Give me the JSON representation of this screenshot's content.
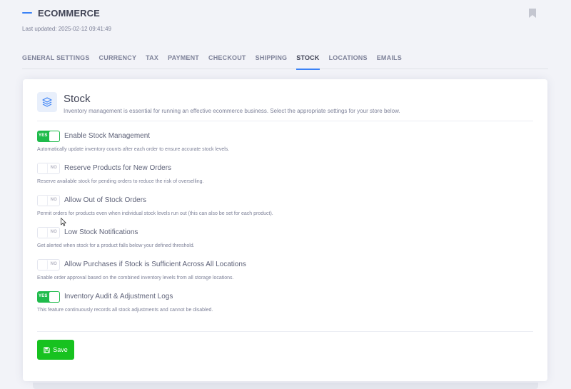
{
  "header": {
    "title": "ECOMMERCE",
    "last_updated": "Last updated: 2025-02-12 09:41:49"
  },
  "tabs": [
    {
      "label": "GENERAL SETTINGS",
      "active": false
    },
    {
      "label": "CURRENCY",
      "active": false
    },
    {
      "label": "TAX",
      "active": false
    },
    {
      "label": "PAYMENT",
      "active": false
    },
    {
      "label": "CHECKOUT",
      "active": false
    },
    {
      "label": "SHIPPING",
      "active": false
    },
    {
      "label": "STOCK",
      "active": true
    },
    {
      "label": "LOCATIONS",
      "active": false
    },
    {
      "label": "EMAILS",
      "active": false
    }
  ],
  "section": {
    "title": "Stock",
    "description": "Inventory management is essential for running an effective ecommerce business. Select the appropriate settings for your store below."
  },
  "options": [
    {
      "label": "Enable Stock Management",
      "state": "YES",
      "help": "Automatically update inventory counts after each order to ensure accurate stock levels."
    },
    {
      "label": "Reserve Products for New Orders",
      "state": "NO",
      "help": "Reserve available stock for pending orders to reduce the risk of overselling."
    },
    {
      "label": "Allow Out of Stock Orders",
      "state": "NO",
      "help": "Permit orders for products even when individual stock levels run out (this can also be set for each product)."
    },
    {
      "label": "Low Stock Notifications",
      "state": "NO",
      "help": "Get alerted when stock for a product falls below your defined threshold."
    },
    {
      "label": "Allow Purchases if Stock is Sufficient Across All Locations",
      "state": "NO",
      "help": "Enable order approval based on the combined inventory levels from all storage locations."
    },
    {
      "label": "Inventory Audit & Adjustment Logs",
      "state": "YES",
      "help": "This feature continuously records all stock adjustments and cannot be disabled."
    }
  ],
  "save_label": "Save",
  "colors": {
    "accent": "#3b82f6",
    "toggle_on": "#1fbb4b",
    "save_button": "#17c21f"
  }
}
